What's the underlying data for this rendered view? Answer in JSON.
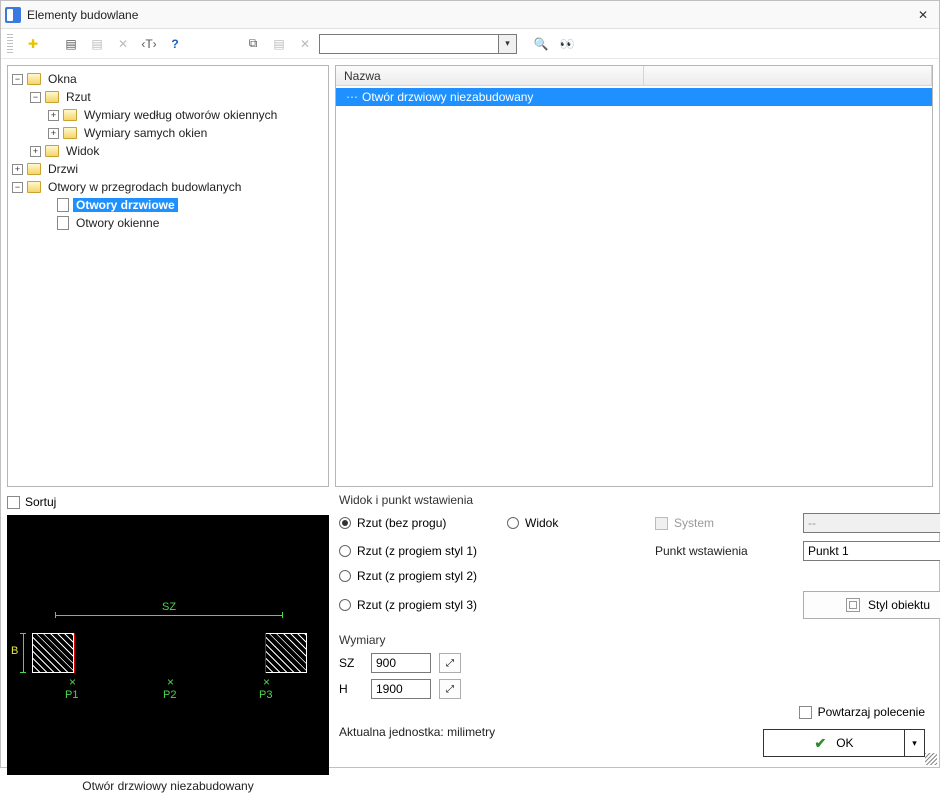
{
  "window": {
    "title": "Elementy budowlane"
  },
  "toolbar": {
    "search_value": ""
  },
  "tree": {
    "okna": "Okna",
    "rzut": "Rzut",
    "wymiary_wg_otworow": "Wymiary według otworów okiennych",
    "wymiary_samych_okien": "Wymiary samych okien",
    "widok": "Widok",
    "drzwi": "Drzwi",
    "otwory_przegrody": "Otwory w przegrodach budowlanych",
    "otwory_drzwiowe": "Otwory drzwiowe",
    "otwory_okienne": "Otwory okienne"
  },
  "list": {
    "header_col1": "Nazwa",
    "row1": "Otwór drzwiowy niezabudowany"
  },
  "sortuj": "Sortuj",
  "preview_caption": "Otwór drzwiowy niezabudowany",
  "preview_labels": {
    "sz": "SZ",
    "b": "B",
    "p1": "P1",
    "p2": "P2",
    "p3": "P3"
  },
  "options": {
    "section_view": "Widok i punkt wstawienia",
    "radio_rzut_bez": "Rzut (bez progu)",
    "radio_rzut_s1": "Rzut (z progiem styl 1)",
    "radio_rzut_s2": "Rzut (z progiem styl 2)",
    "radio_rzut_s3": "Rzut (z progiem styl 3)",
    "radio_widok": "Widok",
    "chk_system": "System",
    "system_value": "--",
    "punkt_label": "Punkt wstawienia",
    "punkt_value": "Punkt 1",
    "styl_btn": "Styl obiektu",
    "section_dims": "Wymiary",
    "sz_label": "SZ",
    "sz_value": "900",
    "h_label": "H",
    "h_value": "1900",
    "unit_line": "Aktualna jednostka: milimetry",
    "repeat_label": "Powtarzaj polecenie",
    "ok": "OK"
  }
}
